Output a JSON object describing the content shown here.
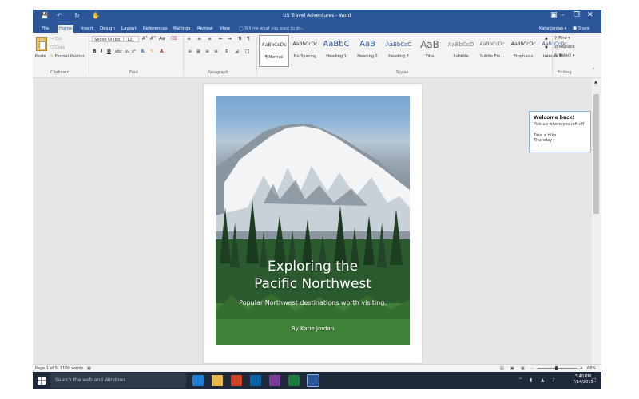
{
  "window": {
    "title": "US Travel Adventures - Word",
    "user": "Katie Jordan",
    "share_label": "Share"
  },
  "tabs": [
    {
      "label": "File"
    },
    {
      "label": "Home",
      "active": true
    },
    {
      "label": "Insert"
    },
    {
      "label": "Design"
    },
    {
      "label": "Layout"
    },
    {
      "label": "References"
    },
    {
      "label": "Mailings"
    },
    {
      "label": "Review"
    },
    {
      "label": "View"
    }
  ],
  "tell_me": "Tell me what you want to do...",
  "ribbon": {
    "clipboard": {
      "paste": "Paste",
      "cut": "Cut",
      "copy": "Copy",
      "format_painter": "Format Painter",
      "label": "Clipboard"
    },
    "font": {
      "name": "Segoe UI (Bo",
      "size": "12",
      "label": "Font"
    },
    "paragraph": {
      "label": "Paragraph"
    },
    "styles": {
      "label": "Styles",
      "items": [
        {
          "preview": "AaBbCcDc",
          "name": "¶ Normal",
          "selected": true
        },
        {
          "preview": "AaBbCcDc",
          "name": "No Spacing"
        },
        {
          "preview": "AaBbC",
          "name": "Heading 1"
        },
        {
          "preview": "AaB",
          "name": "Heading 2"
        },
        {
          "preview": "AaBbCcC",
          "name": "Heading 3"
        },
        {
          "preview": "AaB",
          "name": "Title"
        },
        {
          "preview": "AaBbCcD",
          "name": "Subtitle"
        },
        {
          "preview": "AaBbCcDc",
          "name": "Subtle Em..."
        },
        {
          "preview": "AaBbCcDc",
          "name": "Emphasis"
        },
        {
          "preview": "AaBbCcDc",
          "name": "Intense E..."
        }
      ]
    },
    "editing": {
      "find": "Find",
      "replace": "Replace",
      "select": "Select",
      "label": "Editing"
    }
  },
  "document": {
    "title_line1": "Exploring the",
    "title_line2": "Pacific Northwest",
    "subtitle": "Popular Northwest destinations worth visiting.",
    "byline": "By Katie Jordan"
  },
  "notification": {
    "heading": "Welcome back!",
    "body": "Pick up where you left off:",
    "item_line1": "Take a Hike",
    "item_line2": "Thursday"
  },
  "status": {
    "page": "Page 1 of 5",
    "words": "1100 words",
    "zoom": "68%"
  },
  "taskbar": {
    "search_placeholder": "Search the web and Windows",
    "time": "3:40 PM",
    "date": "7/14/2015"
  }
}
